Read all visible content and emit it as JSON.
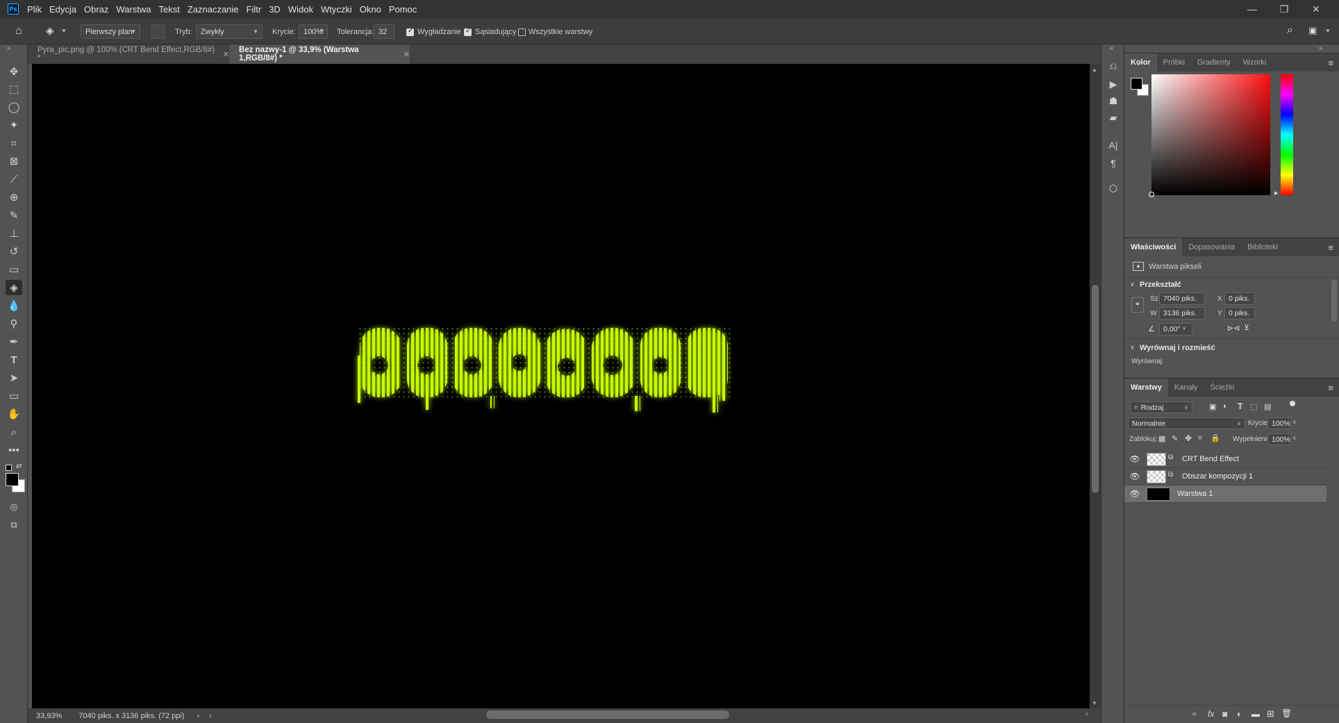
{
  "menubar": {
    "logo": "Ps",
    "items": [
      "Plik",
      "Edycja",
      "Obraz",
      "Warstwa",
      "Tekst",
      "Zaznaczanie",
      "Filtr",
      "3D",
      "Widok",
      "Wtyczki",
      "Okno",
      "Pomoc"
    ],
    "window_controls": [
      "—",
      "❐",
      "✕"
    ]
  },
  "options": {
    "fill_source": "Pierwszy plan",
    "mode_label": "Tryb:",
    "mode_value": "Zwykły",
    "opacity_label": "Krycie:",
    "opacity_value": "100%",
    "tolerance_label": "Tolerancja:",
    "tolerance_value": "32",
    "antialias_label": "Wygładzanie",
    "antialias_checked": true,
    "contiguous_label": "Sąsiadujący",
    "contiguous_checked": true,
    "all_layers_label": "Wszystkie warstwy",
    "all_layers_checked": false
  },
  "tabs": [
    {
      "label": "Pyra_pic.png @ 100% (CRT Bend Effect,RGB/8#) *",
      "active": false
    },
    {
      "label": "Bez nazwy-1 @ 33,9% (Warstwa 1,RGB/8#) *",
      "active": true
    }
  ],
  "status": {
    "zoom": "33,93%",
    "doc_info": "7040 piks. x 3136 piks. (72 ppi)"
  },
  "color_panel": {
    "tabs": [
      "Kolor",
      "Próbki",
      "Gradienty",
      "Wzorki"
    ],
    "foreground": "#000000",
    "background": "#ffffff"
  },
  "properties_panel": {
    "tabs": [
      "Właściwości",
      "Dopasowania",
      "Biblioteki"
    ],
    "layer_type": "Warstwa pikseli",
    "transform_head": "Przekształć",
    "w_label": "Sz",
    "w_value": "7040 piks.",
    "h_label": "W",
    "h_value": "3136 piks.",
    "x_label": "X",
    "x_value": "0 piks.",
    "y_label": "Y",
    "y_value": "0 piks.",
    "angle_value": "0,00°",
    "align_head": "Wyrównaj i rozmieść",
    "align_label": "Wyrównaj:"
  },
  "layers_panel": {
    "tabs": [
      "Warstwy",
      "Kanały",
      "Ścieżki"
    ],
    "filter_value": "Rodzaj",
    "blend_mode": "Normalnie",
    "opacity_label": "Krycie:",
    "opacity_value": "100%",
    "lock_label": "Zablokuj:",
    "fill_label": "Wypełnienie:",
    "fill_value": "100%",
    "layers": [
      {
        "name": "CRT Bend Effect",
        "selected": false
      },
      {
        "name": "Obszar kompozycji 1",
        "selected": false
      },
      {
        "name": "Warstwa 1",
        "selected": true
      }
    ]
  },
  "canvas": {
    "glow_color": "#c8ff00"
  }
}
